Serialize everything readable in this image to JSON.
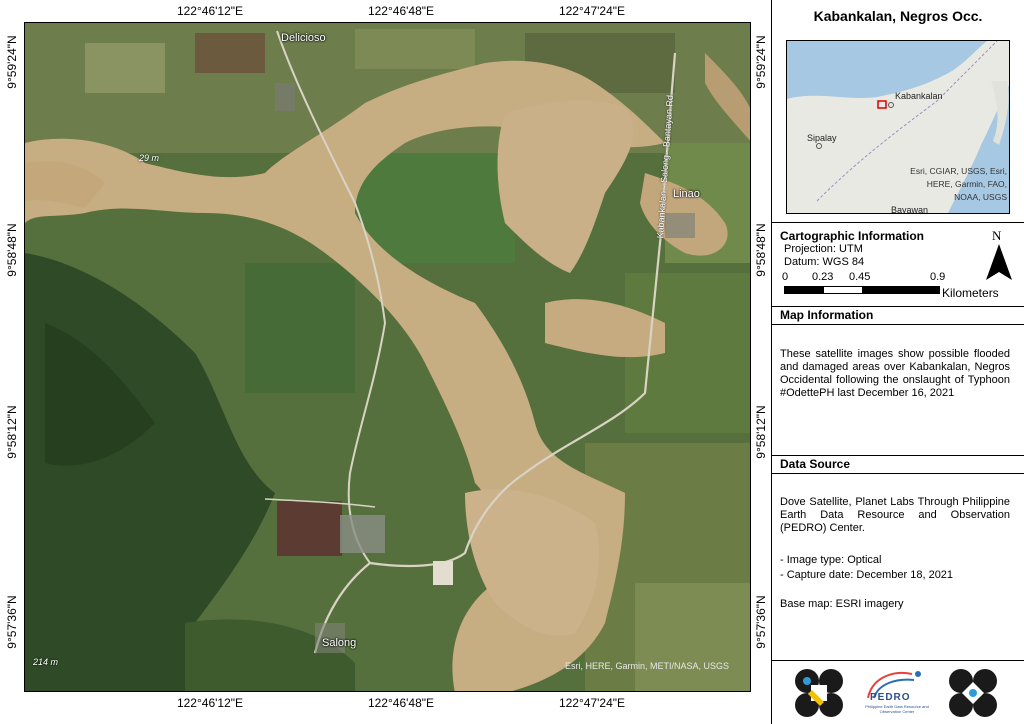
{
  "map": {
    "lon_labels": [
      "122°46'12\"E",
      "122°46'48\"E",
      "122°47'24\"E"
    ],
    "lat_labels": [
      "9°59'24\"N",
      "9°58'48\"N",
      "9°58'12\"N",
      "9°57'36\"N"
    ],
    "places": {
      "delicioso": "Delicioso",
      "linao": "Linao",
      "salong": "Salong"
    },
    "elevations": {
      "upper": "29 m",
      "lower": "214 m"
    },
    "road_label": "Kabankalan - Salong - Bantayan Rd",
    "attribution": "Esri, HERE, Garmin, METI/NASA, USGS",
    "colors": {
      "flood": "#c7ad82",
      "vegetation_dark": "#2f4a26",
      "vegetation": "#4d6b3a",
      "field_light": "#8c9a63",
      "road": "#d9d3c4"
    }
  },
  "panel": {
    "title": "Kabankalan, Negros Occ.",
    "inset": {
      "labels": {
        "kabankalan": "Kabankalan",
        "sipalay": "Sipalay",
        "bayawan": "Bayawan"
      },
      "attribution": "Esri, CGIAR, USGS, Esri, HERE, Garmin, FAO, NOAA, USGS"
    },
    "cartographic": {
      "heading": "Cartographic Information",
      "projection": "Projection: UTM",
      "datum": "Datum: WGS 84",
      "scale_labels": [
        "0",
        "0.23",
        "0.45",
        "0.9"
      ],
      "scale_unit": "Kilometers",
      "north_label": "N"
    },
    "map_information": {
      "heading": "Map Information",
      "text": "These satellite images show possible flooded and damaged areas over Kabankalan, Negros Occidental following the onslaught of Typhoon #OdettePH last December 16, 2021"
    },
    "data_source": {
      "heading": "Data Source",
      "text": "Dove Satellite, Planet Labs Through Philippine Earth Data Resource and Observation (PEDRO) Center.",
      "image_type": "- Image type: Optical",
      "capture_date": "- Capture date: December 18, 2021",
      "base_map": "Base map: ESRI imagery"
    },
    "logos": {
      "pedro_name": "PEDRO",
      "pedro_subtitle": "Philippine Earth Data Resource and Observation Center"
    }
  }
}
